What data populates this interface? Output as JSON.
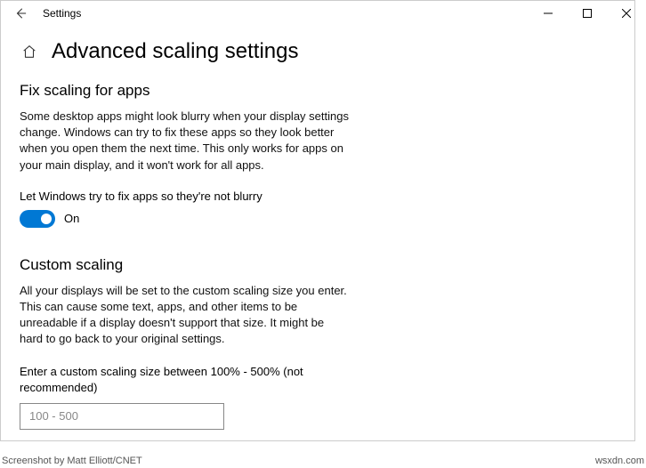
{
  "titlebar": {
    "app_name": "Settings"
  },
  "page": {
    "title": "Advanced scaling settings"
  },
  "section1": {
    "title": "Fix scaling for apps",
    "desc": "Some desktop apps might look blurry when your display settings change. Windows can try to fix these apps so they look better when you open them the next time. This only works for apps on your main display, and it won't work for all apps.",
    "toggle_label": "Let Windows try to fix apps so they're not blurry",
    "toggle_state": "On"
  },
  "section2": {
    "title": "Custom scaling",
    "desc": "All your displays will be set to the custom scaling size you enter. This can cause some text, apps, and other items to be unreadable if a display doesn't support that size. It might be hard to go back to your original settings.",
    "input_label": "Enter a custom scaling size between 100% - 500% (not recommended)",
    "input_placeholder": "100 - 500"
  },
  "footer": {
    "credit": "Screenshot by Matt Elliott/CNET",
    "source": "wsxdn.com"
  }
}
